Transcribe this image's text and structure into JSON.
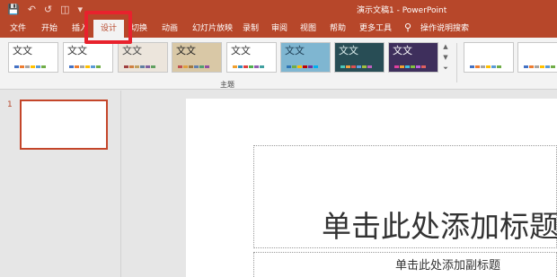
{
  "app": {
    "title": "演示文稿1  -  PowerPoint"
  },
  "qat": {
    "save_icon": "save-icon",
    "undo_icon": "undo-icon",
    "redo_icon": "redo-icon",
    "start_from_beginning_icon": "start-from-beginning-icon",
    "customize_icon": "customize-qat-icon"
  },
  "tabs": [
    {
      "label": "文件"
    },
    {
      "label": "开始"
    },
    {
      "label": "插入"
    },
    {
      "label": "设计"
    },
    {
      "label": "切换"
    },
    {
      "label": "动画"
    },
    {
      "label": "幻灯片放映"
    },
    {
      "label": "录制"
    },
    {
      "label": "审阅"
    },
    {
      "label": "视图"
    },
    {
      "label": "帮助"
    },
    {
      "label": "更多工具"
    }
  ],
  "tell_me": {
    "label": "操作说明搜索",
    "icon": "lightbulb-icon"
  },
  "themes": {
    "group_label": "主题",
    "items": [
      {
        "label": "文文",
        "bg": "#ffffff",
        "fg": "#333333",
        "colors": [
          "#4472c4",
          "#ed7d31",
          "#a5a5a5",
          "#ffc000",
          "#5b9bd5",
          "#70ad47"
        ]
      },
      {
        "label": "文文",
        "bg": "#ffffff",
        "fg": "#333333",
        "colors": [
          "#4472c4",
          "#ed7d31",
          "#a5a5a5",
          "#ffc000",
          "#5b9bd5",
          "#70ad47"
        ]
      },
      {
        "label": "文文",
        "bg": "#ece5dc",
        "fg": "#444444",
        "colors": [
          "#a04040",
          "#d08040",
          "#c0a060",
          "#6080a0",
          "#8060a0",
          "#60a060"
        ]
      },
      {
        "label": "文文",
        "bg": "#d9c8a6",
        "fg": "#222222",
        "colors": [
          "#c05050",
          "#e0a040",
          "#a07840",
          "#6080b0",
          "#50a070",
          "#9050a0"
        ]
      },
      {
        "label": "文文",
        "bg": "#ffffff",
        "fg": "#333333",
        "colors": [
          "#f0a030",
          "#3090c0",
          "#e04040",
          "#50b050",
          "#9060b0",
          "#40a0a0"
        ]
      },
      {
        "label": "文文",
        "bg": "#7fb6d1",
        "fg": "#1d3c52",
        "colors": [
          "#2e75b6",
          "#70ad47",
          "#ffc000",
          "#c00000",
          "#7030a0",
          "#00b0f0"
        ]
      },
      {
        "label": "文文",
        "bg": "#284d55",
        "fg": "#e0f0f0",
        "colors": [
          "#4cc6b8",
          "#f0a040",
          "#e05050",
          "#60a0e0",
          "#a0c040",
          "#c060c0"
        ]
      },
      {
        "label": "文文",
        "bg": "#3e2f5c",
        "fg": "#ffffff",
        "colors": [
          "#e040a0",
          "#f0a030",
          "#40c0e0",
          "#80c040",
          "#c060e0",
          "#e06060"
        ]
      }
    ]
  },
  "variants": [
    {
      "bg": "#ffffff",
      "colors": [
        "#4472c4",
        "#ed7d31",
        "#a5a5a5",
        "#ffc000",
        "#5b9bd5",
        "#70ad47"
      ]
    },
    {
      "bg": "#ffffff",
      "colors": [
        "#4472c4",
        "#ed7d31",
        "#a5a5a5",
        "#ffc000",
        "#5b9bd5",
        "#70ad47"
      ]
    }
  ],
  "slides_pane": {
    "slide_number": "1"
  },
  "slide": {
    "title_placeholder": "单击此处添加标题",
    "subtitle_placeholder": "单击此处添加副标题"
  },
  "colors": {
    "brand": "#b7472a",
    "highlight": "#e8222d"
  }
}
